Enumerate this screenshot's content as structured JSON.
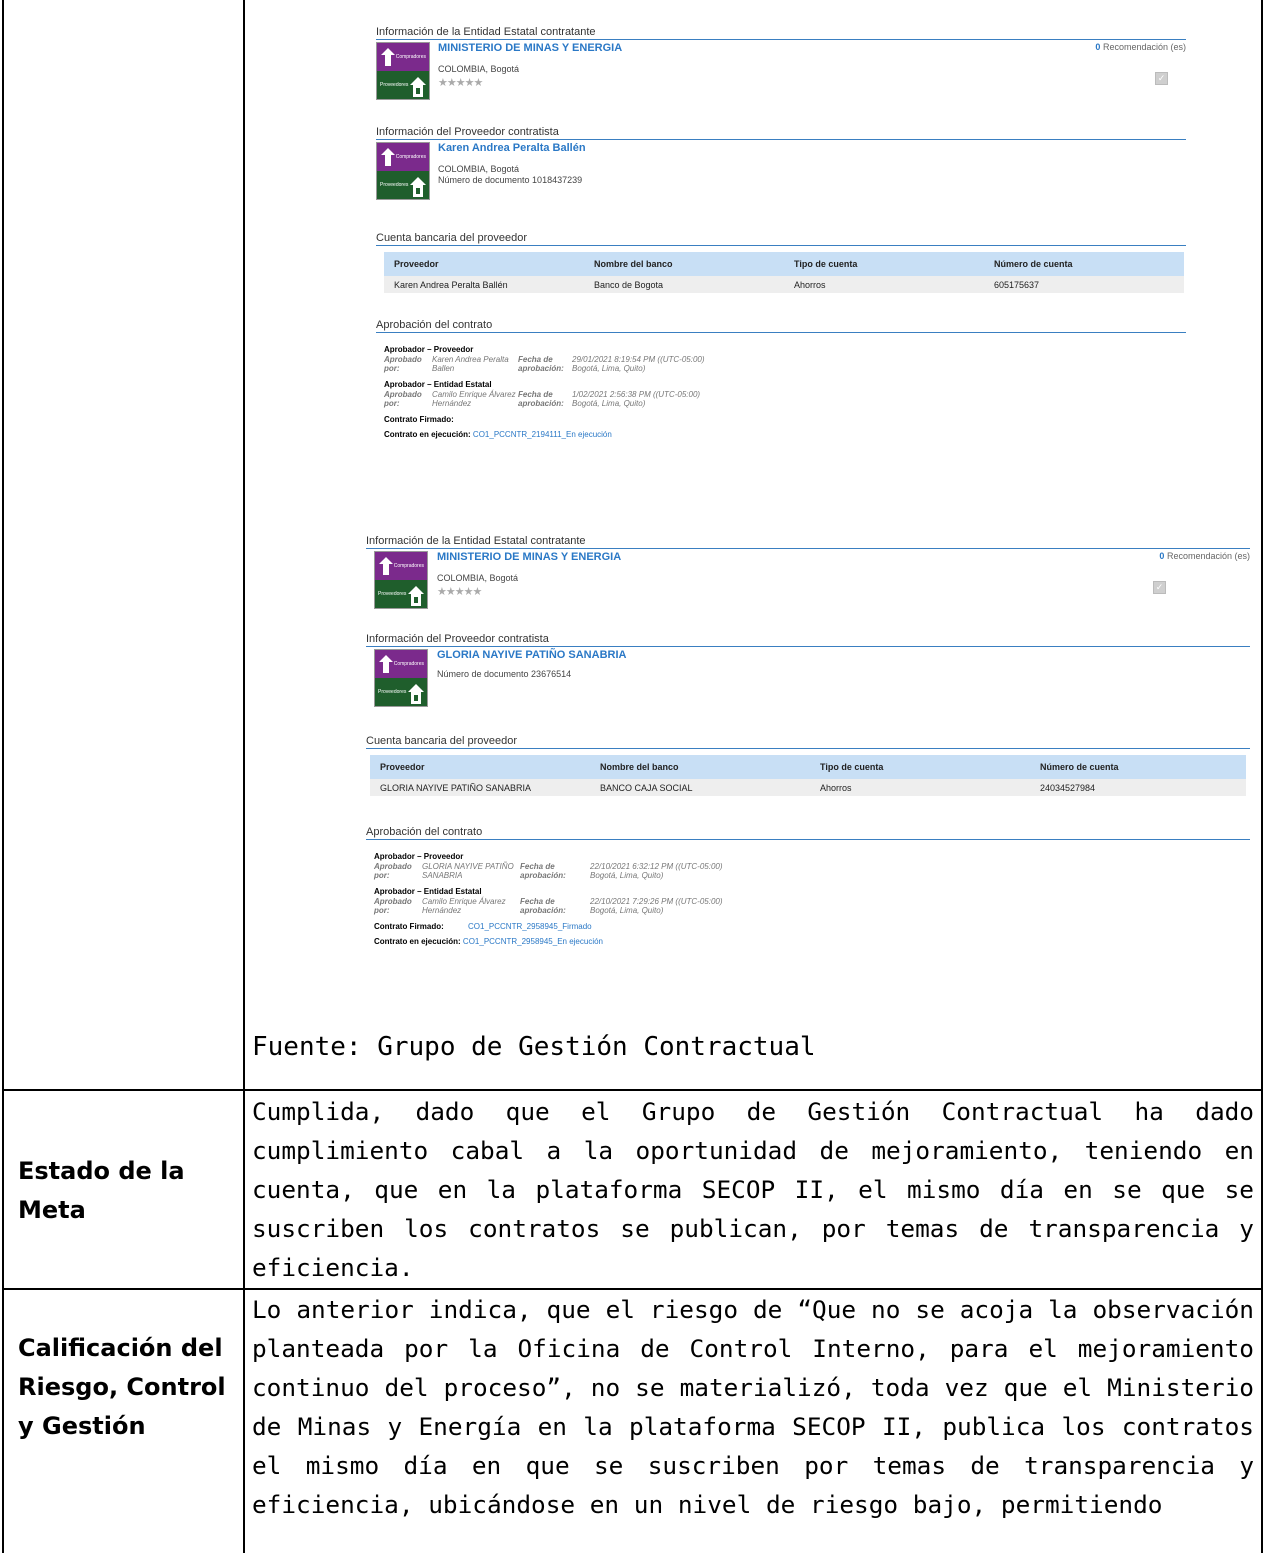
{
  "screenshot1": {
    "entity_title": "Información de la Entidad Estatal contratante",
    "entity_name": "MINISTERIO DE MINAS Y ENERGIA",
    "entity_location": "COLOMBIA, Bogotá",
    "recommend_count": "0",
    "recommend_label": "Recomendación (es)",
    "provider_title": "Información del Proveedor contratista",
    "provider_name": "Karen Andrea Peralta Ballén",
    "provider_location": "COLOMBIA, Bogotá",
    "provider_doc": "Número de documento 1018437239",
    "bank_title": "Cuenta bancaria del proveedor",
    "bank_headers": [
      "Proveedor",
      "Nombre del banco",
      "Tipo de cuenta",
      "Número de cuenta"
    ],
    "bank_row": [
      "Karen Andrea Peralta Ballén",
      "Banco de Bogota",
      "Ahorros",
      "605175637"
    ],
    "approval_title": "Aprobación del contrato",
    "ap1_head": "Aprobador – Proveedor",
    "ap1_by_label": "Aprobado por:",
    "ap1_by": "Karen Andrea Peralta Ballen",
    "ap1_date_label": "Fecha de aprobación:",
    "ap1_date": "29/01/2021 8:19:54 PM ((UTC-05:00) Bogotá, Lima, Quito)",
    "ap2_head": "Aprobador – Entidad Estatal",
    "ap2_by_label": "Aprobado por:",
    "ap2_by": "Camilo Enrique Álvarez Hernández",
    "ap2_date_label": "Fecha de aprobación:",
    "ap2_date": "1/02/2021 2:56:38 PM ((UTC-05:00) Bogotá, Lima, Quito)",
    "signed_label": "Contrato Firmado:",
    "signed_link": "",
    "exec_label": "Contrato en ejecución:",
    "exec_link": "CO1_PCCNTR_2194111_En ejecución"
  },
  "screenshot2": {
    "entity_title": "Información de la Entidad Estatal contratante",
    "entity_name": "MINISTERIO DE MINAS Y ENERGIA",
    "entity_location": "COLOMBIA, Bogotá",
    "recommend_count": "0",
    "recommend_label": "Recomendación (es)",
    "provider_title": "Información del Proveedor contratista",
    "provider_name": "GLORIA NAYIVE PATIÑO SANABRIA",
    "provider_doc": "Número de documento 23676514",
    "bank_title": "Cuenta bancaria del proveedor",
    "bank_headers": [
      "Proveedor",
      "Nombre del banco",
      "Tipo de cuenta",
      "Número de cuenta"
    ],
    "bank_row": [
      "GLORIA NAYIVE PATIÑO SANABRIA",
      "BANCO CAJA SOCIAL",
      "Ahorros",
      "24034527984"
    ],
    "approval_title": "Aprobación del contrato",
    "ap1_head": "Aprobador – Proveedor",
    "ap1_by_label": "Aprobado por:",
    "ap1_by": "GLORIA NAYIVE PATIÑO SANABRIA",
    "ap1_date_label": "Fecha de aprobación:",
    "ap1_date": "22/10/2021 6:32:12 PM ((UTC-05:00) Bogotá, Lima, Quito)",
    "ap2_head": "Aprobador – Entidad Estatal",
    "ap2_by_label": "Aprobado por:",
    "ap2_by": "Camilo Enrique Álvarez Hernández",
    "ap2_date_label": "Fecha de aprobación:",
    "ap2_date": "22/10/2021 7:29:26 PM ((UTC-05:00) Bogotá, Lima, Quito)",
    "signed_label": "Contrato Firmado:",
    "signed_link": "CO1_PCCNTR_2958945_Firmado",
    "exec_label": "Contrato en ejecución:",
    "exec_link": "CO1_PCCNTR_2958945_En ejecución"
  },
  "logo": {
    "top_text": "Compradores",
    "bottom_text": "Proveedores"
  },
  "stars": "★★★★★",
  "source_note": "Fuente: Grupo de Gestión Contractual",
  "rows": [
    {
      "label": "Estado de la Meta",
      "text": "Cumplida, dado que el Grupo de Gestión Contractual ha dado cumplimiento cabal a la oportunidad de mejoramiento, teniendo en cuenta, que en la plataforma SECOP II, el mismo día en se que se suscriben los contratos se publican, por temas de transparencia y eficiencia."
    },
    {
      "label": "Calificación del Riesgo, Control y Gestión",
      "text": "Lo anterior indica, que el riesgo de “Que no se acoja la observación planteada por la Oficina de Control Interno, para el mejoramiento continuo del proceso”, no se materializó, toda vez que el Ministerio de Minas y Energía en la plataforma SECOP II, publica los contratos el mismo día en que se suscriben por temas de transparencia y eficiencia, ubicándose en un nivel de riesgo bajo, permitiendo"
    }
  ],
  "colors": {
    "link": "#2a78c6",
    "purple": "#7b2a8c",
    "green": "#1f5e2c",
    "table_header": "#c8dff5"
  }
}
